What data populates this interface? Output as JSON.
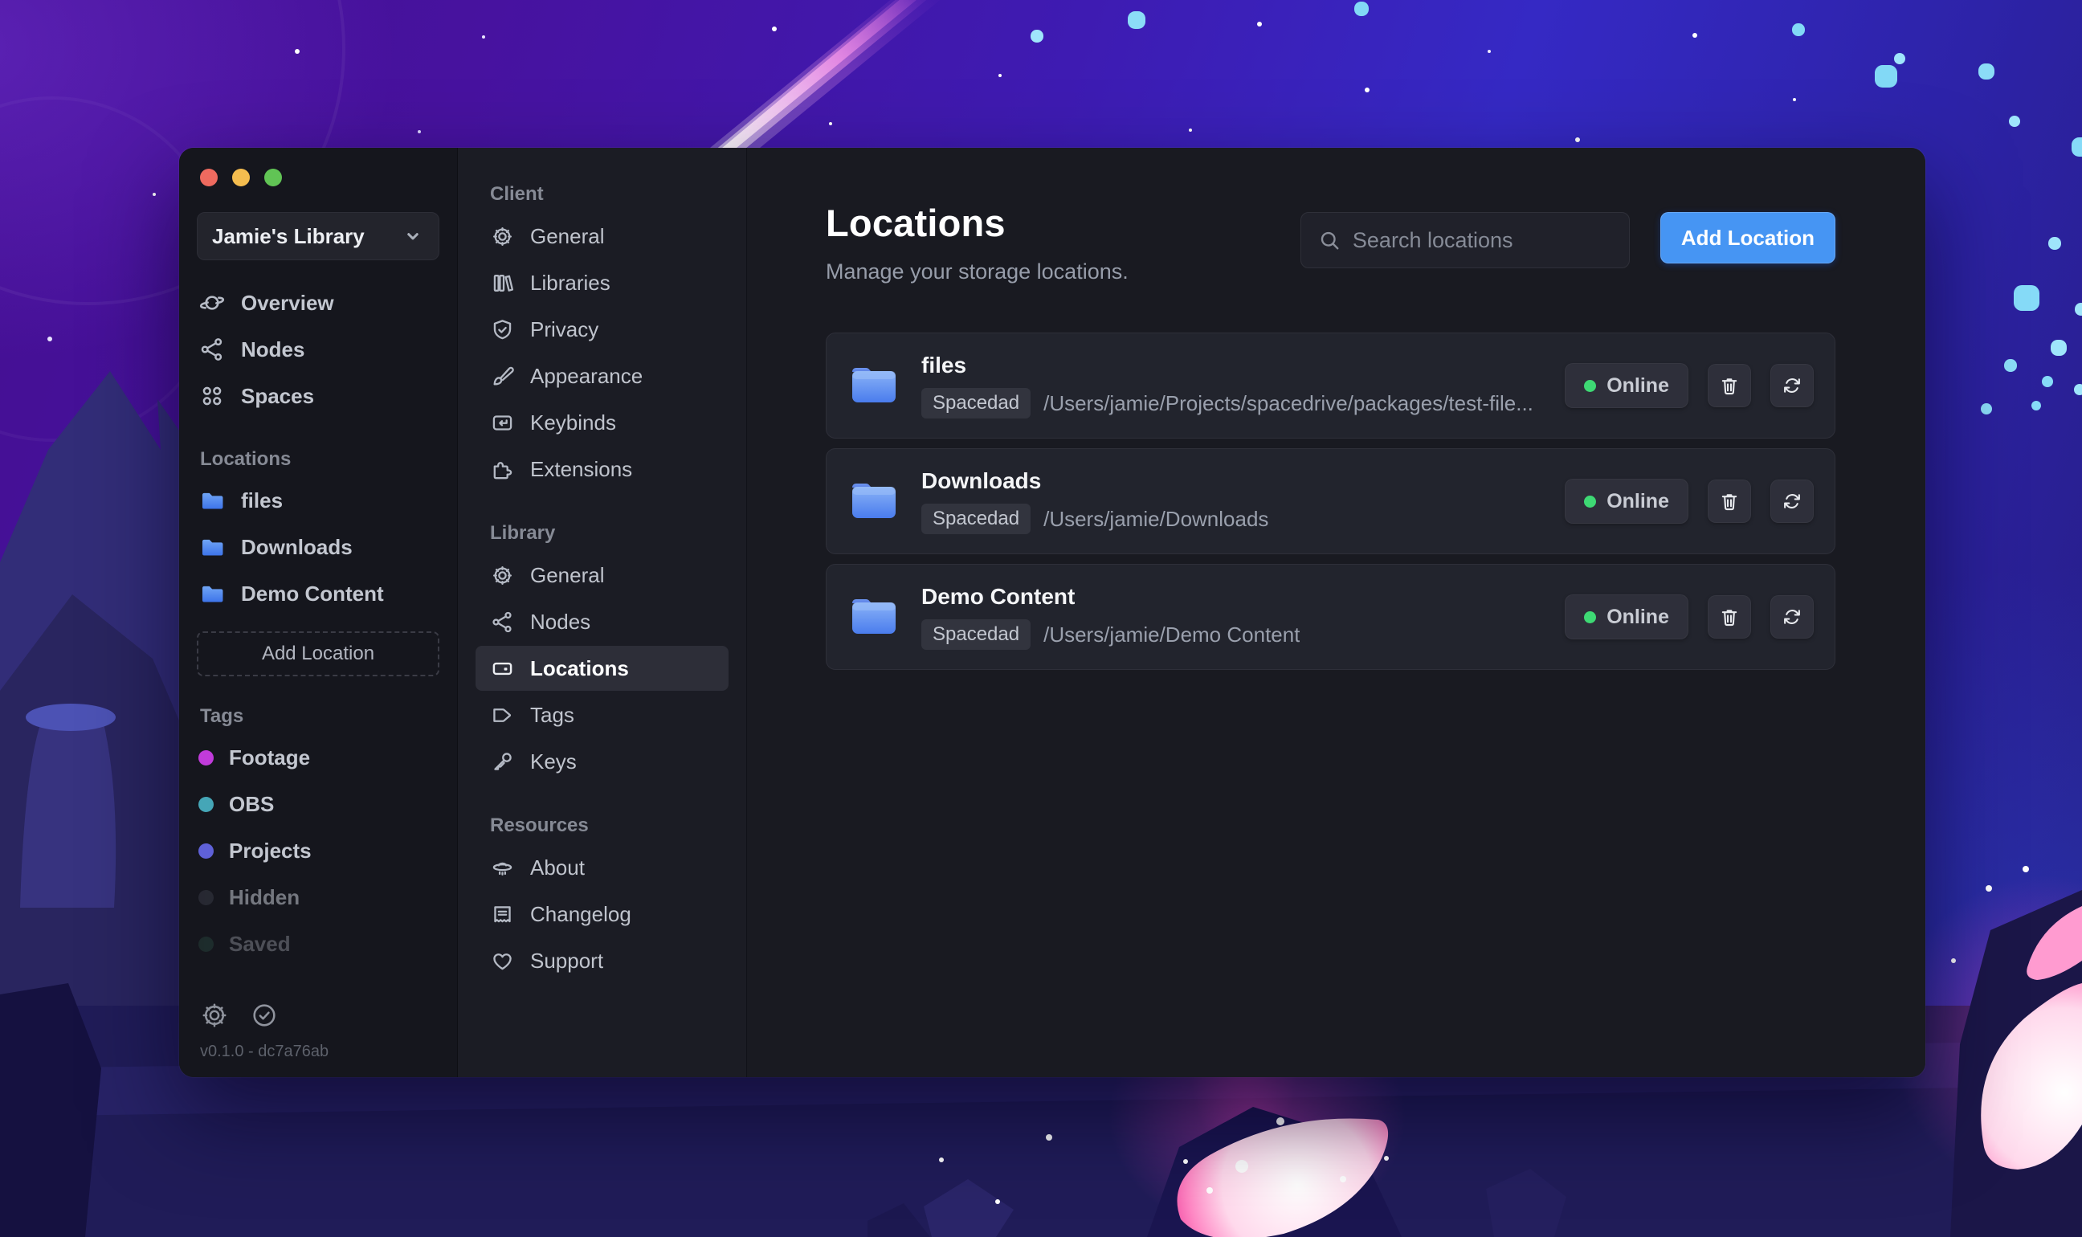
{
  "colors": {
    "accent": "#4695f3",
    "online_green": "#3ed974",
    "traffic_red": "#ee6a5f",
    "traffic_yellow": "#f5bd4f",
    "traffic_green": "#61c455"
  },
  "sidebar": {
    "library_selector": {
      "label": "Jamie's Library"
    },
    "nav": [
      {
        "label": "Overview",
        "icon": "planet"
      },
      {
        "label": "Nodes",
        "icon": "share-network"
      },
      {
        "label": "Spaces",
        "icon": "squares-four"
      }
    ],
    "locations_header": "Locations",
    "locations": [
      {
        "label": "files"
      },
      {
        "label": "Downloads"
      },
      {
        "label": "Demo Content"
      }
    ],
    "add_location_label": "Add Location",
    "tags_header": "Tags",
    "tags": [
      {
        "label": "Footage",
        "color": "#c13bdb",
        "opacity": "1"
      },
      {
        "label": "OBS",
        "color": "#45a6b7",
        "opacity": "1"
      },
      {
        "label": "Projects",
        "color": "#5f61d8",
        "opacity": "1"
      },
      {
        "label": "Hidden",
        "color": "#373944",
        "opacity": "0.55"
      },
      {
        "label": "Saved",
        "color": "#2f5a4c",
        "opacity": "0.32"
      }
    ],
    "footer": {
      "version": "v0.1.0 - dc7a76ab"
    }
  },
  "settings_nav": {
    "sections": [
      {
        "header": "Client",
        "items": [
          {
            "label": "General"
          },
          {
            "label": "Libraries"
          },
          {
            "label": "Privacy"
          },
          {
            "label": "Appearance"
          },
          {
            "label": "Keybinds"
          },
          {
            "label": "Extensions"
          }
        ]
      },
      {
        "header": "Library",
        "items": [
          {
            "label": "General"
          },
          {
            "label": "Nodes"
          },
          {
            "label": "Locations"
          },
          {
            "label": "Tags"
          },
          {
            "label": "Keys"
          }
        ]
      },
      {
        "header": "Resources",
        "items": [
          {
            "label": "About"
          },
          {
            "label": "Changelog"
          },
          {
            "label": "Support"
          }
        ]
      }
    ]
  },
  "main": {
    "title": "Locations",
    "subtitle": "Manage your storage locations.",
    "search": {
      "placeholder": "Search locations"
    },
    "add_button_label": "Add Location",
    "locations": [
      {
        "name": "files",
        "node": "Spacedad",
        "path": "/Users/jamie/Projects/spacedrive/packages/test-file...",
        "status": "Online"
      },
      {
        "name": "Downloads",
        "node": "Spacedad",
        "path": "/Users/jamie/Downloads",
        "status": "Online"
      },
      {
        "name": "Demo Content",
        "node": "Spacedad",
        "path": "/Users/jamie/Demo Content",
        "status": "Online"
      }
    ]
  }
}
